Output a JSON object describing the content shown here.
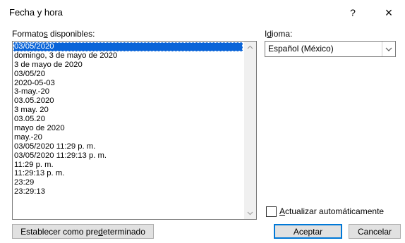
{
  "window": {
    "title": "Fecha y hora",
    "help_label": "?",
    "close_label": "×"
  },
  "formats": {
    "label_pre": "Formato",
    "label_accel": "s",
    "label_post": " disponibles:",
    "items": [
      "03/05/2020",
      "domingo, 3 de mayo de 2020",
      "3 de mayo de 2020",
      "03/05/20",
      "2020-05-03",
      "3-may.-20",
      "03.05.2020",
      "3 may. 20",
      "03.05.20",
      "mayo de 2020",
      "may.-20",
      "03/05/2020 11:29 p. m.",
      "03/05/2020 11:29:13 p. m.",
      "11:29 p. m.",
      "11:29:13 p. m.",
      "23:29",
      "23:29:13"
    ],
    "selected_index": 0
  },
  "language": {
    "label_pre": "I",
    "label_accel": "d",
    "label_post": "ioma:",
    "value": "Español (México)"
  },
  "auto_update": {
    "label_accel": "A",
    "label_post": "ctualizar automáticamente",
    "checked": false
  },
  "buttons": {
    "set_default_pre": "Establecer como pre",
    "set_default_accel": "d",
    "set_default_post": "eterminado",
    "ok": "Aceptar",
    "cancel": "Cancelar"
  },
  "colors": {
    "selection": "#0a64d8",
    "default_button_border": "#0078d7"
  }
}
